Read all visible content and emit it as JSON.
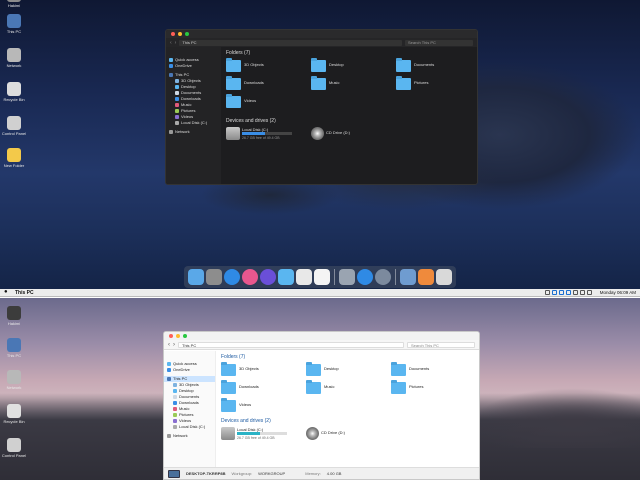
{
  "top": {
    "desktop_icons": [
      {
        "label": "Hakimi",
        "color": "#8c8c8c"
      },
      {
        "label": "This PC",
        "color": "#4a77b5"
      },
      {
        "label": "Network",
        "color": "#b8b8b8"
      },
      {
        "label": "Recycle Bin",
        "color": "#dddddd"
      },
      {
        "label": "Control Panel",
        "color": "#d0d0d0"
      },
      {
        "label": "New Folder",
        "color": "#f3c94a"
      }
    ],
    "window": {
      "address": "This PC",
      "search_placeholder": "Search This PC",
      "sidebar": [
        {
          "label": "Quick access",
          "sub": false,
          "color": "#5ab6f0"
        },
        {
          "label": "OneDrive",
          "sub": false,
          "color": "#3a8ee6"
        },
        {
          "label": "This PC",
          "sub": false,
          "color": "#4a77b5"
        },
        {
          "label": "3D Objects",
          "sub": true,
          "color": "#7fb3e0"
        },
        {
          "label": "Desktop",
          "sub": true,
          "color": "#5ab6f0"
        },
        {
          "label": "Documents",
          "sub": true,
          "color": "#cfd8e3"
        },
        {
          "label": "Downloads",
          "sub": true,
          "color": "#3a8ee6"
        },
        {
          "label": "Music",
          "sub": true,
          "color": "#e05a7a"
        },
        {
          "label": "Pictures",
          "sub": true,
          "color": "#9acb57"
        },
        {
          "label": "Videos",
          "sub": true,
          "color": "#8a6fd1"
        },
        {
          "label": "Local Disk (C:)",
          "sub": true,
          "color": "#aaaaaa"
        },
        {
          "label": "Network",
          "sub": false,
          "color": "#999999"
        }
      ],
      "folders_header": "Folders (7)",
      "folders": [
        "3D Objects",
        "Desktop",
        "Documents",
        "Downloads",
        "Music",
        "Pictures",
        "Videos"
      ],
      "drives_header": "Devices and drives (2)",
      "drive": {
        "name": "Local Disk (C:)",
        "free_text": "26.7 GB free of 49.4 GB",
        "used_fraction": 0.46
      },
      "cd": {
        "name": "CD Drive (D:)"
      }
    },
    "dock_apps": [
      {
        "name": "finder-icon",
        "color": "#5aa8e8"
      },
      {
        "name": "settings-icon",
        "color": "#8d8d8d"
      },
      {
        "name": "safari-icon",
        "color": "#2f8ae5"
      },
      {
        "name": "itunes-icon",
        "color": "#e8578e"
      },
      {
        "name": "siri-icon",
        "color": "#6a4fd8"
      },
      {
        "name": "folder-icon",
        "color": "#5ab6f0"
      },
      {
        "name": "contacts-icon",
        "color": "#e8e8e8"
      },
      {
        "name": "calendar-icon",
        "color": "#f4f4f4"
      },
      {
        "name": "launchpad-icon",
        "color": "#9aa4b1"
      },
      {
        "name": "appstore-icon",
        "color": "#2f8ae5"
      },
      {
        "name": "power-icon",
        "color": "#7c8a9e"
      },
      {
        "name": "preview-icon",
        "color": "#6f9cd0"
      },
      {
        "name": "photos-icon",
        "color": "#ef8a3c"
      },
      {
        "name": "trash-icon",
        "color": "#d9d9d9"
      }
    ]
  },
  "menubar": {
    "app_name": "This PC",
    "clock": "Monday 06:09 AM"
  },
  "bottom": {
    "desktop_icons": [
      {
        "label": "Hakimi",
        "color": "#3c3c3c"
      },
      {
        "label": "This PC",
        "color": "#4a77b5"
      },
      {
        "label": "Network",
        "color": "#b8b8b8"
      },
      {
        "label": "Recycle Bin",
        "color": "#e0e0e0"
      },
      {
        "label": "Control Panel",
        "color": "#d0d0d0"
      }
    ],
    "window": {
      "address": "This PC",
      "search_placeholder": "Search This PC",
      "sidebar": [
        {
          "label": "Quick access",
          "sub": false,
          "color": "#5ab6f0",
          "selected": false
        },
        {
          "label": "OneDrive",
          "sub": false,
          "color": "#3a8ee6",
          "selected": false
        },
        {
          "label": "This PC",
          "sub": false,
          "color": "#4a77b5",
          "selected": true
        },
        {
          "label": "3D Objects",
          "sub": true,
          "color": "#7fb3e0",
          "selected": false
        },
        {
          "label": "Desktop",
          "sub": true,
          "color": "#5ab6f0",
          "selected": false
        },
        {
          "label": "Documents",
          "sub": true,
          "color": "#cfd8e3",
          "selected": false
        },
        {
          "label": "Downloads",
          "sub": true,
          "color": "#3a8ee6",
          "selected": false
        },
        {
          "label": "Music",
          "sub": true,
          "color": "#e05a7a",
          "selected": false
        },
        {
          "label": "Pictures",
          "sub": true,
          "color": "#9acb57",
          "selected": false
        },
        {
          "label": "Videos",
          "sub": true,
          "color": "#8a6fd1",
          "selected": false
        },
        {
          "label": "Local Disk (C:)",
          "sub": true,
          "color": "#aaaaaa",
          "selected": false
        },
        {
          "label": "Network",
          "sub": false,
          "color": "#999999",
          "selected": false
        }
      ],
      "folders_header": "Folders (7)",
      "folders": [
        "3D Objects",
        "Desktop",
        "Documents",
        "Downloads",
        "Music",
        "Pictures",
        "Videos"
      ],
      "drives_header": "Devices and drives (2)",
      "drive": {
        "name": "Local Disk (C:)",
        "free_text": "26.7 GB free of 49.4 GB",
        "used_fraction": 0.46
      },
      "cd": {
        "name": "CD Drive (D:)"
      },
      "status": {
        "computer": "DESKTOP-TKRRP8B",
        "workgroup_label": "Workgroup:",
        "workgroup": "WORKGROUP",
        "memory_label": "Memory:",
        "memory": "4.00 GB"
      }
    }
  }
}
